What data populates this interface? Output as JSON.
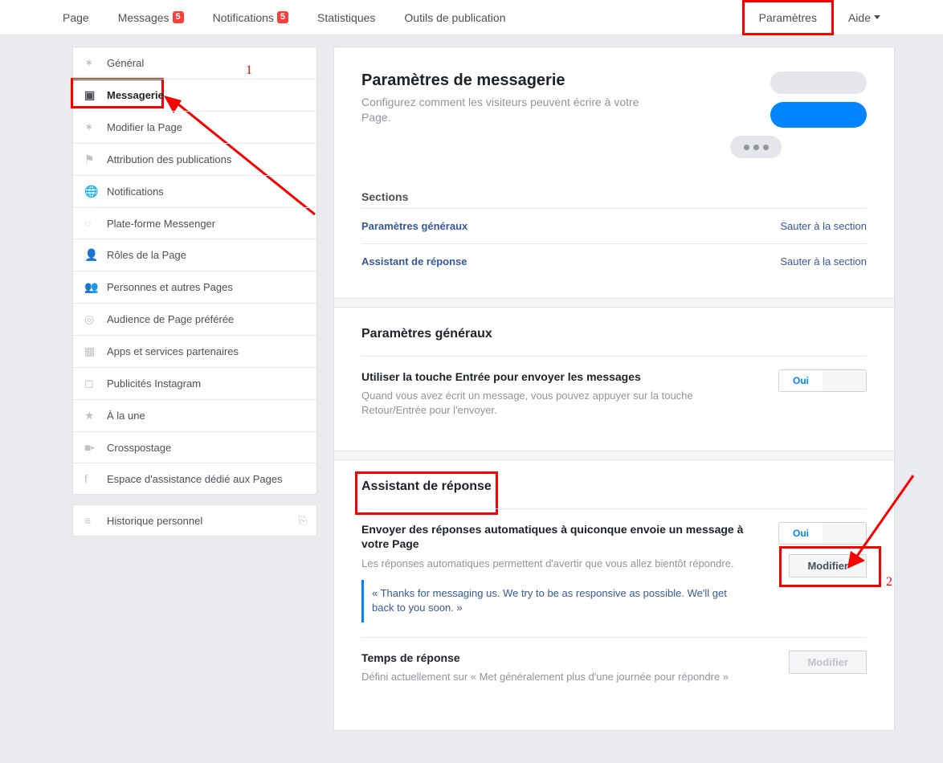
{
  "topnav": {
    "items": [
      {
        "label": "Page"
      },
      {
        "label": "Messages",
        "badge": "5"
      },
      {
        "label": "Notifications",
        "badge": "5"
      },
      {
        "label": "Statistiques"
      },
      {
        "label": "Outils de publication"
      }
    ],
    "right": [
      {
        "label": "Paramètres",
        "highlighted": true
      },
      {
        "label": "Aide",
        "caret": true
      }
    ]
  },
  "sidebar": {
    "items": [
      {
        "label": "Général",
        "icon": "gear"
      },
      {
        "label": "Messagerie",
        "icon": "chat",
        "active": true
      },
      {
        "label": "Modifier la Page",
        "icon": "gear"
      },
      {
        "label": "Attribution des publications",
        "icon": "flag"
      },
      {
        "label": "Notifications",
        "icon": "globe"
      },
      {
        "label": "Plate-forme Messenger",
        "icon": "messenger"
      },
      {
        "label": "Rôles de la Page",
        "icon": "person"
      },
      {
        "label": "Personnes et autres Pages",
        "icon": "people"
      },
      {
        "label": "Audience de Page préférée",
        "icon": "target"
      },
      {
        "label": "Apps et services partenaires",
        "icon": "box"
      },
      {
        "label": "Publicités Instagram",
        "icon": "instagram"
      },
      {
        "label": "À la une",
        "icon": "star"
      },
      {
        "label": "Crosspostage",
        "icon": "video"
      },
      {
        "label": "Espace d'assistance dédié aux Pages",
        "icon": "fb"
      }
    ],
    "history": {
      "label": "Historique personnel",
      "icon": "list"
    }
  },
  "main": {
    "title": "Paramètres de messagerie",
    "desc": "Configurez comment les visiteurs peuvent écrire à votre Page.",
    "sections_heading": "Sections",
    "sections": [
      {
        "label": "Paramètres généraux",
        "skip": "Sauter à la section"
      },
      {
        "label": "Assistant de réponse",
        "skip": "Sauter à la section"
      }
    ],
    "general": {
      "heading": "Paramètres généraux",
      "enter": {
        "title": "Utiliser la touche Entrée pour envoyer les messages",
        "desc": "Quand vous avez écrit un message, vous pouvez appuyer sur la touche Retour/Entrée pour l'envoyer.",
        "toggle_on": "Oui",
        "toggle_off": ""
      }
    },
    "assistant": {
      "heading": "Assistant de réponse",
      "auto": {
        "title": "Envoyer des réponses automatiques à quiconque envoie un message à votre Page",
        "desc": "Les réponses automatiques permettent d'avertir que vous allez bientôt répondre.",
        "toggle_on": "Oui",
        "modify": "Modifier",
        "quote": "« Thanks for messaging us. We try to be as responsive as possible. We'll get back to you soon. »"
      },
      "response_time": {
        "title": "Temps de réponse",
        "desc": "Défini actuellement sur « Met généralement plus d'une journée pour répondre »",
        "modify": "Modifier"
      }
    }
  },
  "annotations": {
    "n1": "1",
    "n2": "2"
  }
}
